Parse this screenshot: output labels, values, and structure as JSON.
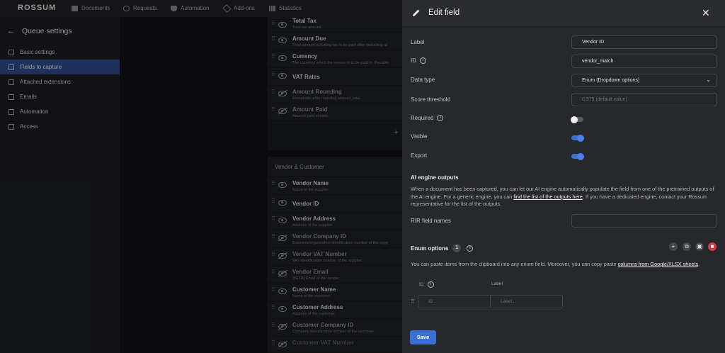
{
  "app": {
    "logo": "ROSSUM"
  },
  "topnav": [
    {
      "label": "Documents",
      "icon": "documents-icon"
    },
    {
      "label": "Requests",
      "icon": "requests-icon"
    },
    {
      "label": "Automation",
      "icon": "automation-icon"
    },
    {
      "label": "Add-ons",
      "icon": "addons-icon"
    },
    {
      "label": "Statistics",
      "icon": "statistics-icon"
    }
  ],
  "sidebar": {
    "title": "Queue settings",
    "items": [
      {
        "label": "Basic settings",
        "active": false
      },
      {
        "label": "Fields to capture",
        "active": true
      },
      {
        "label": "Attached extensions",
        "active": false
      },
      {
        "label": "Emails",
        "active": false
      },
      {
        "label": "Automation",
        "active": false
      },
      {
        "label": "Access",
        "active": false
      }
    ]
  },
  "fields_list": {
    "totals": [
      {
        "name": "Total Tax",
        "desc": "Total tax amount."
      },
      {
        "name": "Amount Due",
        "desc": "Final amount including tax to be paid after deducting all"
      },
      {
        "name": "Currency",
        "desc": "The currency which the invoice is to be paid in. Possible"
      },
      {
        "name": "VAT Rates",
        "desc": ""
      },
      {
        "name": "Amount Rounding",
        "desc": "Remainder after rounding amount_total."
      },
      {
        "name": "Amount Paid",
        "desc": "Amount paid already."
      }
    ],
    "section_vendor": "Vendor & Customer",
    "vendor": [
      {
        "name": "Vendor Name",
        "desc": "Name of the supplier."
      },
      {
        "name": "Vendor ID",
        "desc": ""
      },
      {
        "name": "Vendor Address",
        "desc": "Address of the supplier."
      },
      {
        "name": "Vendor Company ID",
        "desc": "Business/organization identification number of the supp"
      },
      {
        "name": "Vendor VAT Number",
        "desc": "VAT identification number of the supplier."
      },
      {
        "name": "Vendor Email",
        "desc": "[BETA] Email of the sender."
      },
      {
        "name": "Customer Name",
        "desc": "Name of the customer."
      },
      {
        "name": "Customer Address",
        "desc": "Address of the customer."
      },
      {
        "name": "Customer Company ID",
        "desc": "Company identification number of the customer."
      },
      {
        "name": "Customer VAT Number",
        "desc": ""
      }
    ]
  },
  "drawer": {
    "title": "Edit field",
    "label_label": "Label",
    "label_value": "Vendor ID",
    "id_label": "ID",
    "id_value": "vendor_match",
    "datatype_label": "Data type",
    "datatype_value": "Enum (Dropdown options)",
    "score_label": "Score threshold",
    "score_placeholder": "0.975 (default value)",
    "required_label": "Required",
    "visible_label": "Visible",
    "export_label": "Export",
    "required": false,
    "visible": true,
    "export": true,
    "ai_title": "AI engine outputs",
    "ai_text_1": "When a document has been captured, you can let our AI engine automatically populate the field from one of the pretrained outputs of the AI engine. For a generic engine, you can ",
    "ai_link": "find the list of the outputs here",
    "ai_text_2": ". If you have a dedicated engine, contact your Rossum representative for the list of the outputs.",
    "rir_label": "RIR field names",
    "enum_title": "Enum options",
    "enum_count": "1",
    "enum_text_1": "You can paste items from the clipboard into any enum field. Moreover, you can copy paste ",
    "enum_link": "columns from Google/XLSX sheets",
    "enum_text_2": ".",
    "col_id": "ID",
    "col_label": "Label",
    "id_placeholder": "ID...",
    "label_placeholder": "Label...",
    "save_label": "Save"
  }
}
